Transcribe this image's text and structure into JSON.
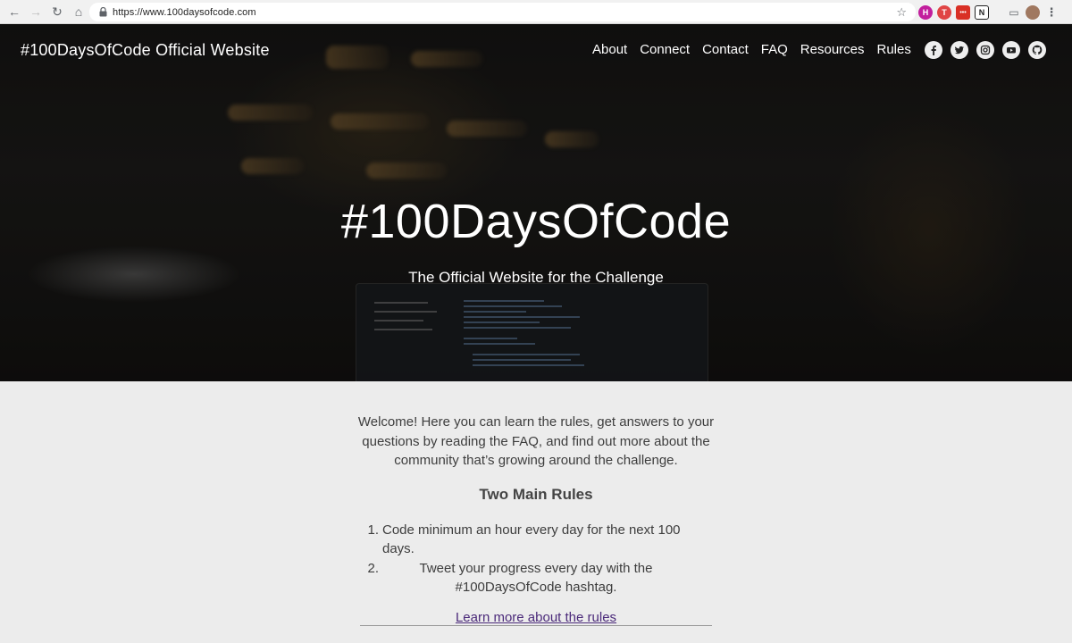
{
  "browser": {
    "url": "https://www.100daysofcode.com",
    "extensions": [
      {
        "name": "hex-extension",
        "letter": "H",
        "color": "#c21f9d"
      },
      {
        "name": "t-extension",
        "letter": "T",
        "color": "#e04545"
      },
      {
        "name": "red-extension",
        "letter": "•••",
        "color": "#d93025"
      },
      {
        "name": "notion-extension",
        "letter": "N",
        "color": "#222222"
      }
    ]
  },
  "header": {
    "site_title": "#100DaysOfCode Official Website",
    "nav": [
      "About",
      "Connect",
      "Contact",
      "FAQ",
      "Resources",
      "Rules"
    ],
    "social": [
      "facebook-icon",
      "twitter-icon",
      "instagram-icon",
      "youtube-icon",
      "github-icon"
    ]
  },
  "hero": {
    "title": "#100DaysOfCode",
    "subtitle": "The Official Website for the Challenge"
  },
  "main": {
    "welcome": "Welcome! Here you can learn the rules, get answers to your questions by reading the FAQ, and find out more about the community that’s growing around the challenge.",
    "rules_heading": "Two Main Rules",
    "rules": [
      {
        "num": "1.",
        "text": "Code minimum an hour every day for the next 100 days."
      },
      {
        "num": "2.",
        "text": "Tweet your progress every day with the #100DaysOfCode hashtag."
      }
    ],
    "learn_more_link": "Learn more about the rules"
  },
  "colors": {
    "link": "#4b2a7a",
    "page_bg": "#ececec"
  }
}
